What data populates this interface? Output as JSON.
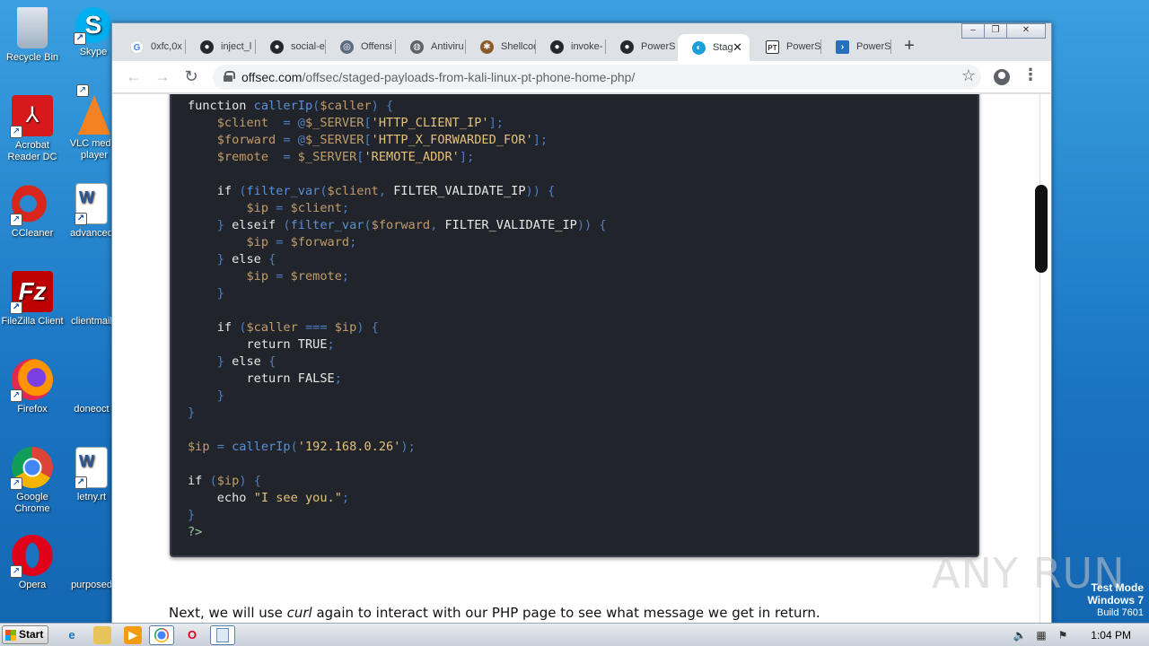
{
  "desktop": {
    "icons": [
      {
        "label": "Recycle Bin"
      },
      {
        "label": "Skype"
      },
      {
        "label": "Acrobat Reader DC"
      },
      {
        "label": "VLC media player"
      },
      {
        "label": "CCleaner"
      },
      {
        "label": "advanced"
      },
      {
        "label": "FileZilla Client"
      },
      {
        "label": "clientmail"
      },
      {
        "label": "Firefox"
      },
      {
        "label": "doneoct"
      },
      {
        "label": "Google Chrome"
      },
      {
        "label": "letny.rt"
      },
      {
        "label": "Opera"
      },
      {
        "label": "purposed"
      }
    ]
  },
  "browser": {
    "tabs": [
      {
        "label": "0xfc,0x",
        "icon": "google-icon",
        "color": "#4285f4"
      },
      {
        "label": "inject_l",
        "icon": "github-icon",
        "color": "#24292e"
      },
      {
        "label": "social-e",
        "icon": "github-icon",
        "color": "#24292e"
      },
      {
        "label": "Offensi",
        "icon": "offsec-icon",
        "color": "#5b6b80"
      },
      {
        "label": "Antiviru",
        "icon": "globe-icon",
        "color": "#5f6368"
      },
      {
        "label": "Shellcod",
        "icon": "bug-icon",
        "color": "#8a5a2b"
      },
      {
        "label": "invoke-",
        "icon": "github-icon",
        "color": "#24292e"
      },
      {
        "label": "PowerS",
        "icon": "github-icon",
        "color": "#24292e"
      },
      {
        "label": "Stag",
        "icon": "offsec-icon",
        "color": "#1a9fd9"
      },
      {
        "label": "PowerS",
        "icon": "pt-icon",
        "color": "#333333"
      },
      {
        "label": "PowerS",
        "icon": "powershell-icon",
        "color": "#2671be"
      }
    ],
    "active_tab_index": 8,
    "url_host": "offsec.com",
    "url_path": "/offsec/staged-payloads-from-kali-linux-pt-phone-home-php/",
    "window_controls": {
      "minimize": "‒",
      "restore": "❐",
      "close": "✕"
    }
  },
  "page": {
    "code_lines": [
      "function callerIp($caller) {",
      "    $client  = @$_SERVER['HTTP_CLIENT_IP'];",
      "    $forward = @$_SERVER['HTTP_X_FORWARDED_FOR'];",
      "    $remote  = $_SERVER['REMOTE_ADDR'];",
      "",
      "    if (filter_var($client, FILTER_VALIDATE_IP)) {",
      "        $ip = $client;",
      "    } elseif (filter_var($forward, FILTER_VALIDATE_IP)) {",
      "        $ip = $forward;",
      "    } else {",
      "        $ip = $remote;",
      "    }",
      "",
      "    if ($caller === $ip) {",
      "        return TRUE;",
      "    } else {",
      "        return FALSE;",
      "    }",
      "}",
      "",
      "$ip = callerIp('192.168.0.26');",
      "",
      "if ($ip) {",
      "    echo \"I see you.\";",
      "}",
      "?>"
    ],
    "paragraph_before": "Next, we will use ",
    "paragraph_em": "curl",
    "paragraph_after": " again to interact with our PHP page to see what message we get in return."
  },
  "watermark": "ANY RUN",
  "os": {
    "test_mode": "Test Mode",
    "windows_version": "Windows 7",
    "build": "Build 7601",
    "start_label": "Start",
    "clock": "1:04 PM"
  }
}
